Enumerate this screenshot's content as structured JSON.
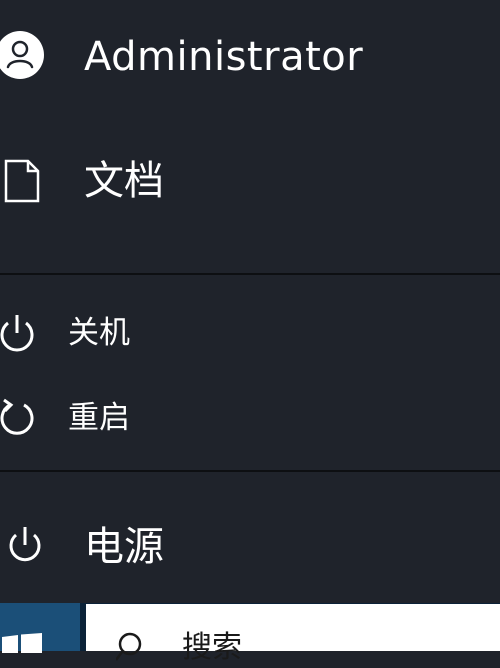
{
  "start_menu": {
    "user": {
      "label": "Administrator",
      "icon": "user-avatar-icon"
    },
    "documents": {
      "label": "文档",
      "icon": "document-icon"
    },
    "power_options": [
      {
        "label": "关机",
        "icon": "power-icon"
      },
      {
        "label": "重启",
        "icon": "restart-icon"
      }
    ],
    "power": {
      "label": "电源",
      "icon": "power-icon"
    }
  },
  "taskbar": {
    "start_icon": "windows-logo-icon",
    "search": {
      "placeholder": "搜索",
      "icon": "search-icon"
    }
  },
  "colors": {
    "menu_bg": "#1f232b",
    "divider": "#0d0f12",
    "taskbar_bg": "#0b2238",
    "start_tile": "#1b4f78",
    "search_bg": "#ffffff"
  }
}
